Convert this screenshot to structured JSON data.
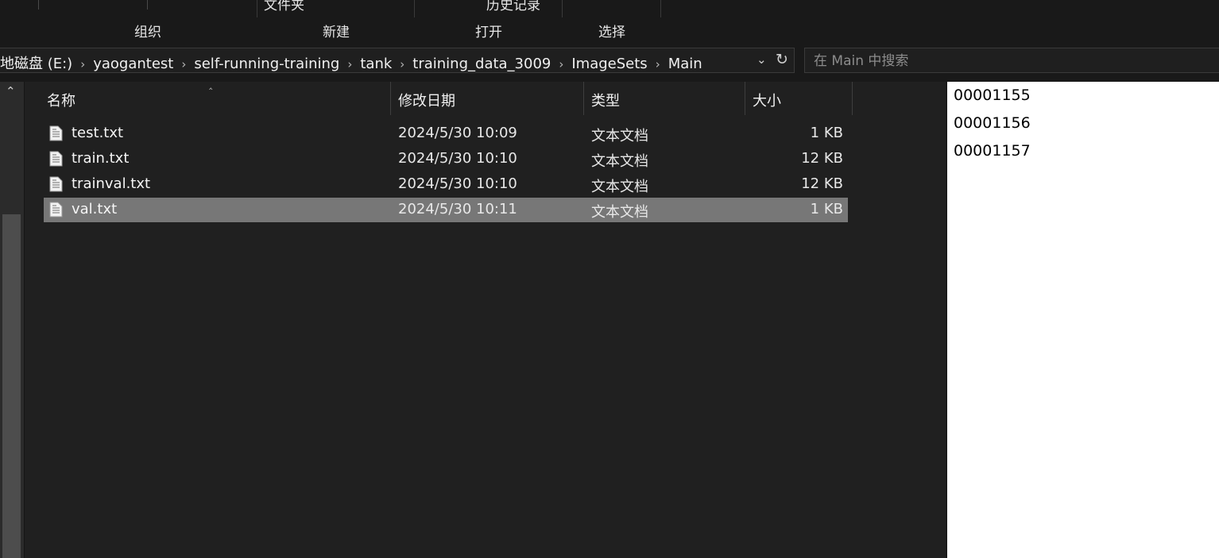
{
  "ribbon": {
    "groups": [
      "组织",
      "新建",
      "打开",
      "选择"
    ],
    "cut_off_labels": {
      "new_folder": "文件夹",
      "history": "历史记录"
    }
  },
  "address": {
    "crumbs": [
      "地磁盘 (E:)",
      "yaogantest",
      "self-running-training",
      "tank",
      "training_data_3009",
      "ImageSets",
      "Main"
    ],
    "dropdown_icon": "chevron-down-icon",
    "refresh_icon": "refresh-icon"
  },
  "search": {
    "placeholder": "在 Main 中搜索",
    "value": ""
  },
  "columns": {
    "name": "名称",
    "date": "修改日期",
    "type": "类型",
    "size": "大小"
  },
  "files": [
    {
      "name": "test.txt",
      "date": "2024/5/30 10:09",
      "type": "文本文档",
      "size": "1 KB",
      "selected": false
    },
    {
      "name": "train.txt",
      "date": "2024/5/30 10:10",
      "type": "文本文档",
      "size": "12 KB",
      "selected": false
    },
    {
      "name": "trainval.txt",
      "date": "2024/5/30 10:10",
      "type": "文本文档",
      "size": "12 KB",
      "selected": false
    },
    {
      "name": "val.txt",
      "date": "2024/5/30 10:11",
      "type": "文本文档",
      "size": "1 KB",
      "selected": true
    }
  ],
  "preview": {
    "lines": [
      "00001155",
      "00001156",
      "00001157"
    ]
  },
  "colors": {
    "background": "#191919",
    "pane": "#202020",
    "selection": "#777777",
    "preview_bg": "#ffffff"
  }
}
